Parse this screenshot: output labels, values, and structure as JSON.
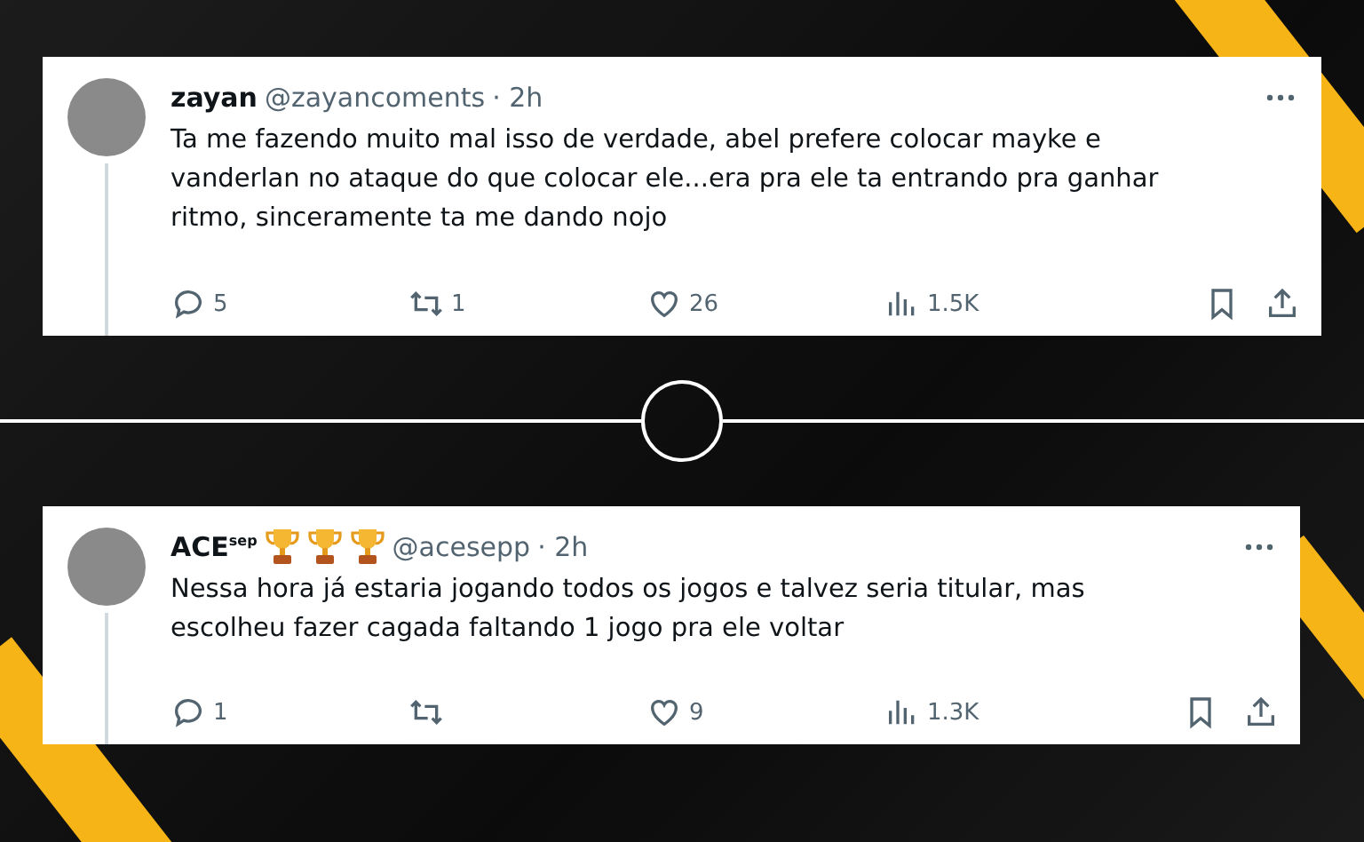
{
  "tweets": [
    {
      "name": "zayan",
      "handle": "@zayancoments",
      "time": "· 2h",
      "text": [
        "Ta me fazendo muito mal isso de verdade, abel prefere colocar mayke e",
        "vanderlan no ataque do que colocar ele...era pra ele ta entrando pra ganhar",
        "ritmo, sinceramente ta me dando nojo"
      ],
      "actions": [
        {
          "kind": "reply",
          "count": "5"
        },
        {
          "kind": "retweet",
          "count": "1"
        },
        {
          "kind": "like",
          "count": "26"
        },
        {
          "kind": "views",
          "count": "1.5K"
        },
        {
          "kind": "bookmark"
        },
        {
          "kind": "share"
        }
      ]
    },
    {
      "name": "ACE$^{sep}$",
      "handle": "@acesepp",
      "time": "· 2h",
      "badges": [
        {
          "kind": "trophy"
        },
        {
          "kind": "trophy"
        },
        {
          "kind": "trophy"
        }
      ],
      "text": [
        "Nessa hora já estaria jogando todos os jogos e talvez seria titular, mas",
        "escolheu fazer cagada faltando 1 jogo pra ele voltar"
      ],
      "actions": [
        {
          "kind": "reply",
          "count": "1"
        },
        {
          "kind": "retweet"
        },
        {
          "kind": "like",
          "count": "9"
        },
        {
          "kind": "views",
          "count": "1.3K"
        },
        {
          "kind": "bookmark"
        },
        {
          "kind": "share"
        }
      ]
    }
  ]
}
